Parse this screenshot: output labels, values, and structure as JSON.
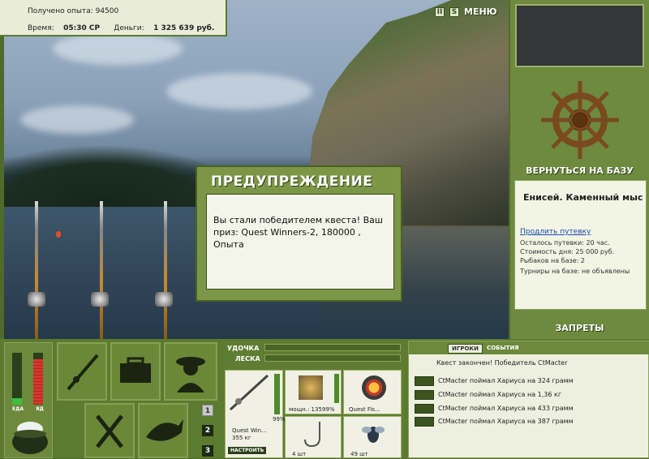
{
  "stats": {
    "exp_label": "Получено опыта: 94500",
    "time_label": "Время:",
    "time_value": "05:30 СР",
    "money_label": "Деньги:",
    "money_value": "1 325 639 руб."
  },
  "top": {
    "pause": "II",
    "sound": "S",
    "menu": "МЕНЮ"
  },
  "side": {
    "back": "ВЕРНУТЬСЯ НА БАЗУ",
    "location": "Енисей. Каменный мыс",
    "extend": "Продлить путевку",
    "lines": [
      "Осталось путевки: 20 час.",
      "Стоимость дня: 25 000 руб.",
      "Рыбаков на базе: 2",
      "Турниры на базе: не объявлены"
    ],
    "bans": "ЗАПРЕТЫ"
  },
  "dialog": {
    "title": "ПРЕДУПРЕЖДЕНИЕ",
    "message": "Вы стали победителем квеста! Ваш приз: Quest Winners-2, 180000 , Опыта"
  },
  "bottom": {
    "food_label": "ЕДА",
    "poison_label": "ЯД",
    "pages": [
      "1",
      "2",
      "3"
    ],
    "gauge_colors": {
      "food": "#3cc040",
      "poison": "#d9362c"
    }
  },
  "gear": {
    "rod_label": "УДОЧКА",
    "line_label": "ЛЕСКА",
    "rod_name": "Quest Win...",
    "rod_weight": "355 кг",
    "rod_pct": "99%",
    "setup": "НАСТРОИТЬ",
    "reel_power": "мощн.: 135",
    "reel_pct": "99%",
    "line_name": "Quest Fis...",
    "hook_value": "4 шт",
    "bait_value": "49 шт"
  },
  "log": {
    "tab_players": "ИГРОКИ",
    "tab_events": "СОБЫТИЯ",
    "first": "Квест закончен! Победитель CtMacter",
    "entries": [
      "CtMacter поймал Хариуса на 324 грамм",
      "CtMacter поймал Хариуса на 1,36 кг",
      "CtMacter поймал Хариуса на 433 грамм",
      "CtMacter поймал Хариуса на 387 грамм"
    ]
  }
}
